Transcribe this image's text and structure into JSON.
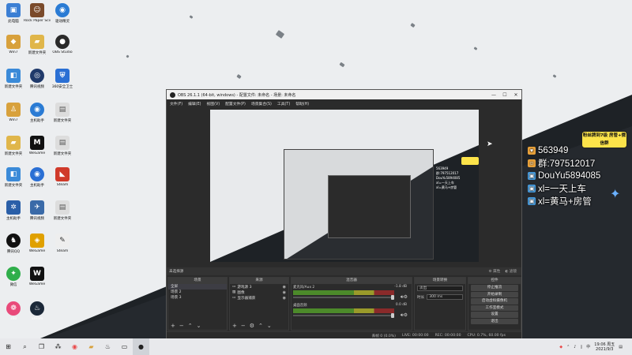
{
  "desktop_icons": [
    {
      "label": "此电脑",
      "icon": "computer-icon",
      "color": "#3b7fd4"
    },
    {
      "label": "Rock Paper Scissors",
      "icon": "app-icon",
      "color": "#7a4a2a"
    },
    {
      "label": "驱动精灵",
      "icon": "driver-icon",
      "color": "#2a7bd4"
    },
    {
      "label": "Win7",
      "icon": "user-icon",
      "color": "#d8a13c"
    },
    {
      "label": "新建文件夹",
      "icon": "folder-icon",
      "color": "#e0b64a"
    },
    {
      "label": "新建文件夹",
      "icon": "network-icon",
      "color": "#3a8ad8"
    },
    {
      "label": "腾讯视频",
      "icon": "app-icon",
      "color": "#203a6a"
    },
    {
      "label": "腾讯QQ",
      "icon": "qq-icon",
      "color": "#111111"
    },
    {
      "label": "微信",
      "icon": "wechat-icon",
      "color": "#2fae4a"
    },
    {
      "label": "360",
      "icon": "browser-icon",
      "color": "#e94a7a"
    },
    {
      "label": "主机助手",
      "icon": "app-icon",
      "color": "#333333"
    },
    {
      "label": "WeGame",
      "icon": "wegame-icon",
      "color": "#e0a000"
    },
    {
      "label": "360安全卫士",
      "icon": "shield-icon",
      "color": "#2a6fd4"
    },
    {
      "label": "WeGame",
      "icon": "game-icon",
      "color": "#111111"
    },
    {
      "label": "Steam",
      "icon": "steam-icon",
      "color": "#1b2838"
    },
    {
      "label": "OBS Studio",
      "icon": "obs-icon",
      "color": "#2a2a2a"
    },
    {
      "label": "Steam",
      "icon": "app-icon",
      "color": "#8e4a2a"
    }
  ],
  "obs": {
    "title": "OBS 26.1.1 (64-bit, windows) - 配置文件: 未命名 - 场景: 未命名",
    "menu": [
      "文件(F)",
      "编辑(E)",
      "视图(V)",
      "配置文件(P)",
      "场景集合(S)",
      "工具(T)",
      "帮助(H)"
    ],
    "preview_overlay": [
      "563949",
      "群:797512017",
      "DouYu5894085",
      "xl=一天上车",
      "xl=黄马+房管"
    ],
    "label_bar": {
      "current": "未选择源",
      "props": "属性",
      "filters": "滤镜"
    },
    "docks": {
      "scenes": {
        "header": "场景",
        "items": [
          "全屏",
          "场景 2",
          "场景 3"
        ]
      },
      "sources": {
        "header": "来源",
        "items": [
          "游戏源 3",
          "图像",
          "显示器捕获"
        ]
      },
      "mixer": {
        "header": "混音器",
        "channels": [
          {
            "name": "麦克风/Aux 2",
            "db": "-1.8 dB"
          },
          {
            "name": "桌面音频",
            "db": "0.0 dB"
          }
        ]
      },
      "transitions": {
        "header": "场景转换",
        "type": "淡出",
        "duration_label": "时长",
        "duration": "300 ms"
      },
      "controls": {
        "header": "控件",
        "buttons": [
          "停止推流",
          "开始录制",
          "启动虚拟摄像机",
          "工作室模式",
          "设置",
          "退出"
        ]
      }
    },
    "status": {
      "drop": "丢帧 0 (0.0%)",
      "live": "LIVE: 00:00:00",
      "rec": "REC: 00:00:00",
      "cpu": "CPU: 0.7%, 60.00 fps"
    }
  },
  "overlay": {
    "badge": "粉丝牌到7级 房管+微信群",
    "lines": [
      {
        "text": "563949",
        "icon": "fan-icon",
        "color": "#e9a23b"
      },
      {
        "text": "群:797512017",
        "icon": "group-icon",
        "color": "#e9a23b"
      },
      {
        "text": "DouYu5894085",
        "icon": "tv-icon",
        "color": "#4aa3e8"
      },
      {
        "text": "xl=一天上车",
        "icon": "tv-icon",
        "color": "#4aa3e8"
      },
      {
        "text": "xl=黄马+房管",
        "icon": "tv-icon",
        "color": "#4aa3e8"
      }
    ]
  },
  "taskbar": {
    "time": "19:06 周五",
    "date": "2021/9/3"
  }
}
